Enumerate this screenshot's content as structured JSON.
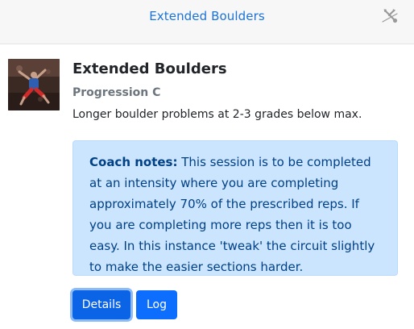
{
  "header": {
    "title": "Extended Boulders",
    "tools_icon": "tools-disabled-icon"
  },
  "session": {
    "thumbnail_icon": "climber-photo",
    "title": "Extended Boulders",
    "progression": "Progression C",
    "description": "Longer boulder problems at 2-3 grades below max."
  },
  "notes": {
    "label": "Coach notes:",
    "text": " This session is to be completed at an intensity where you are completing approximately 70% of the prescribed reps. If you are completing more reps then it is too easy. In this instance 'tweak' the circuit slightly to make the easier sections harder."
  },
  "actions": {
    "details_label": "Details",
    "log_label": "Log"
  },
  "colors": {
    "accent": "#1a73d9",
    "primary_button": "#0d6efd",
    "alert_bg": "#cce5ff",
    "alert_text": "#004085"
  }
}
